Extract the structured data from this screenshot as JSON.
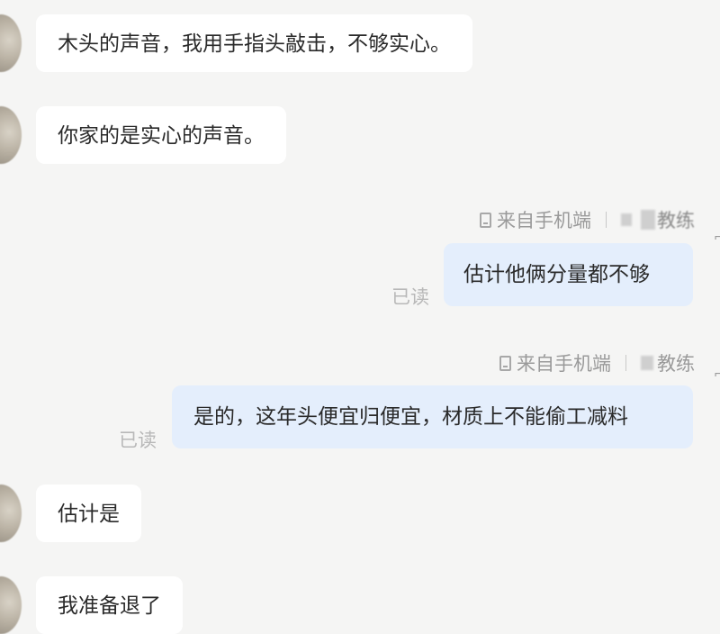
{
  "messages": [
    {
      "text": "木头的声音，我用手指头敲击，不够实心。"
    },
    {
      "text": "你家的是实心的声音。"
    },
    {
      "source": "来自手机端",
      "sender": "教练",
      "text": "估计他俩分量都不够",
      "read": "已读"
    },
    {
      "source": "来自手机端",
      "sender": "教练",
      "text": "是的，这年头便宜归便宜，材质上不能偷工减料",
      "read": "已读"
    },
    {
      "text": "估计是"
    },
    {
      "text": "我准备退了"
    }
  ],
  "icons": {
    "source_device": "phone-icon"
  },
  "colors": {
    "background": "#f5f5f4",
    "received_bubble": "#ffffff",
    "sent_bubble": "#e4eefc",
    "meta_text": "#9a9a9a"
  }
}
